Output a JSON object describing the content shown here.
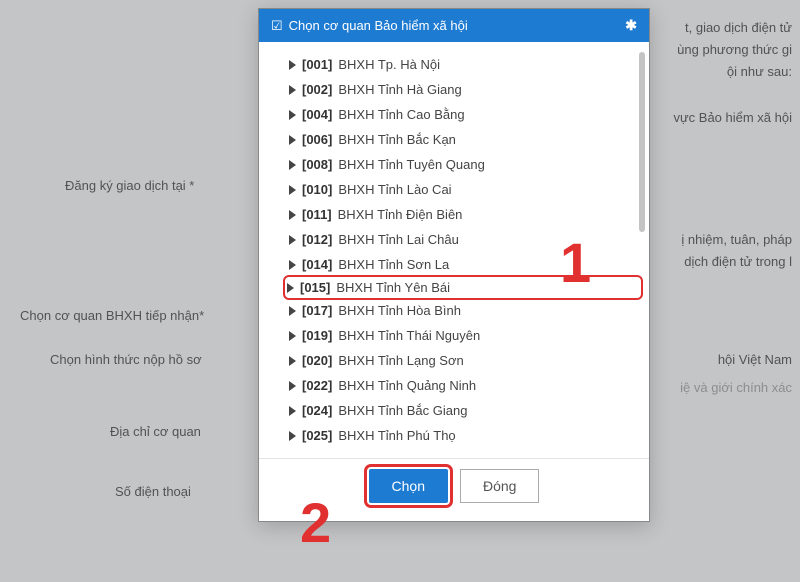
{
  "bg": {
    "right1": "t, giao dịch điện tử",
    "right2": "ùng phương thức gi",
    "right3": "ội như sau:",
    "right4": "vực Bảo hiểm xã hội",
    "right5": "ị nhiệm, tuân, pháp",
    "right6": "dịch điện tử trong l",
    "right7": "hội Việt Nam",
    "right8": "iệ và giới chính xác",
    "f1": "Đăng ký giao dịch tại *",
    "f2": "Chọn cơ quan BHXH tiếp nhận*",
    "f3": "Chọn hình thức nộp hồ sơ",
    "f4": "Địa chỉ cơ quan",
    "f5": "Số điện thoại"
  },
  "modal": {
    "title": "Chọn cơ quan Bảo hiểm xã hội",
    "close": "✱"
  },
  "items": [
    {
      "code": "[001]",
      "label": "BHXH Tp. Hà Nội"
    },
    {
      "code": "[002]",
      "label": "BHXH Tỉnh Hà Giang"
    },
    {
      "code": "[004]",
      "label": "BHXH Tỉnh Cao Bằng"
    },
    {
      "code": "[006]",
      "label": "BHXH Tỉnh Bắc Kạn"
    },
    {
      "code": "[008]",
      "label": "BHXH Tỉnh Tuyên Quang"
    },
    {
      "code": "[010]",
      "label": "BHXH Tỉnh Lào Cai"
    },
    {
      "code": "[011]",
      "label": "BHXH Tỉnh Điện Biên"
    },
    {
      "code": "[012]",
      "label": "BHXH Tỉnh Lai Châu"
    },
    {
      "code": "[014]",
      "label": "BHXH Tỉnh Sơn La"
    },
    {
      "code": "[015]",
      "label": "BHXH Tỉnh Yên Bái"
    },
    {
      "code": "[017]",
      "label": "BHXH Tỉnh Hòa Bình"
    },
    {
      "code": "[019]",
      "label": "BHXH Tỉnh Thái Nguyên"
    },
    {
      "code": "[020]",
      "label": "BHXH Tỉnh Lạng Sơn"
    },
    {
      "code": "[022]",
      "label": "BHXH Tỉnh Quảng Ninh"
    },
    {
      "code": "[024]",
      "label": "BHXH Tỉnh Bắc Giang"
    },
    {
      "code": "[025]",
      "label": "BHXH Tỉnh Phú Thọ"
    }
  ],
  "footer": {
    "select": "Chọn",
    "close": "Đóng"
  },
  "ann": {
    "one": "1",
    "two": "2"
  }
}
